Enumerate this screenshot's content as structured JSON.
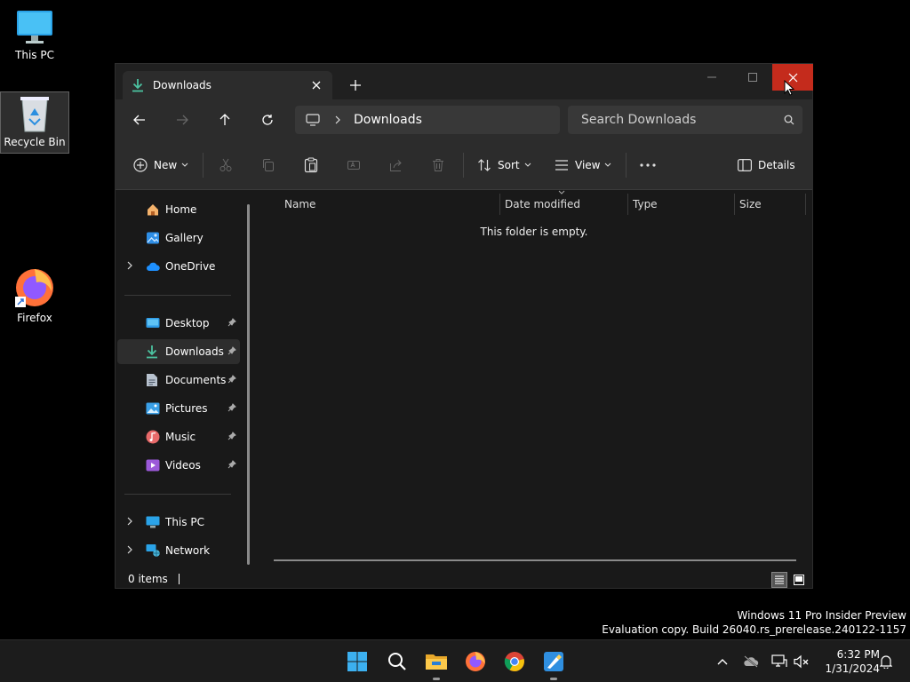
{
  "desktop": {
    "icons": [
      {
        "label": "This PC"
      },
      {
        "label": "Recycle Bin"
      },
      {
        "label": "Firefox"
      }
    ]
  },
  "window": {
    "tab_label": "Downloads",
    "address": {
      "crumb": "Downloads"
    },
    "search": {
      "placeholder": "Search Downloads"
    },
    "commands": {
      "new_label": "New",
      "sort_label": "Sort",
      "view_label": "View",
      "details_label": "Details"
    },
    "nav": {
      "home": "Home",
      "gallery": "Gallery",
      "onedrive": "OneDrive",
      "desktop": "Desktop",
      "downloads": "Downloads",
      "documents": "Documents",
      "pictures": "Pictures",
      "music": "Music",
      "videos": "Videos",
      "thispc": "This PC",
      "network": "Network"
    },
    "columns": {
      "name": "Name",
      "date_modified": "Date modified",
      "type": "Type",
      "size": "Size"
    },
    "empty_message": "This folder is empty.",
    "status": "0 items"
  },
  "watermark": {
    "line1": "Windows 11 Pro Insider Preview",
    "line2": "Evaluation copy. Build 26040.rs_prerelease.240122-1157"
  },
  "clock": {
    "time": "6:32 PM",
    "date": "1/31/2024"
  },
  "colors": {
    "close_button": "#c42b1c",
    "accent": "#60cdff"
  }
}
